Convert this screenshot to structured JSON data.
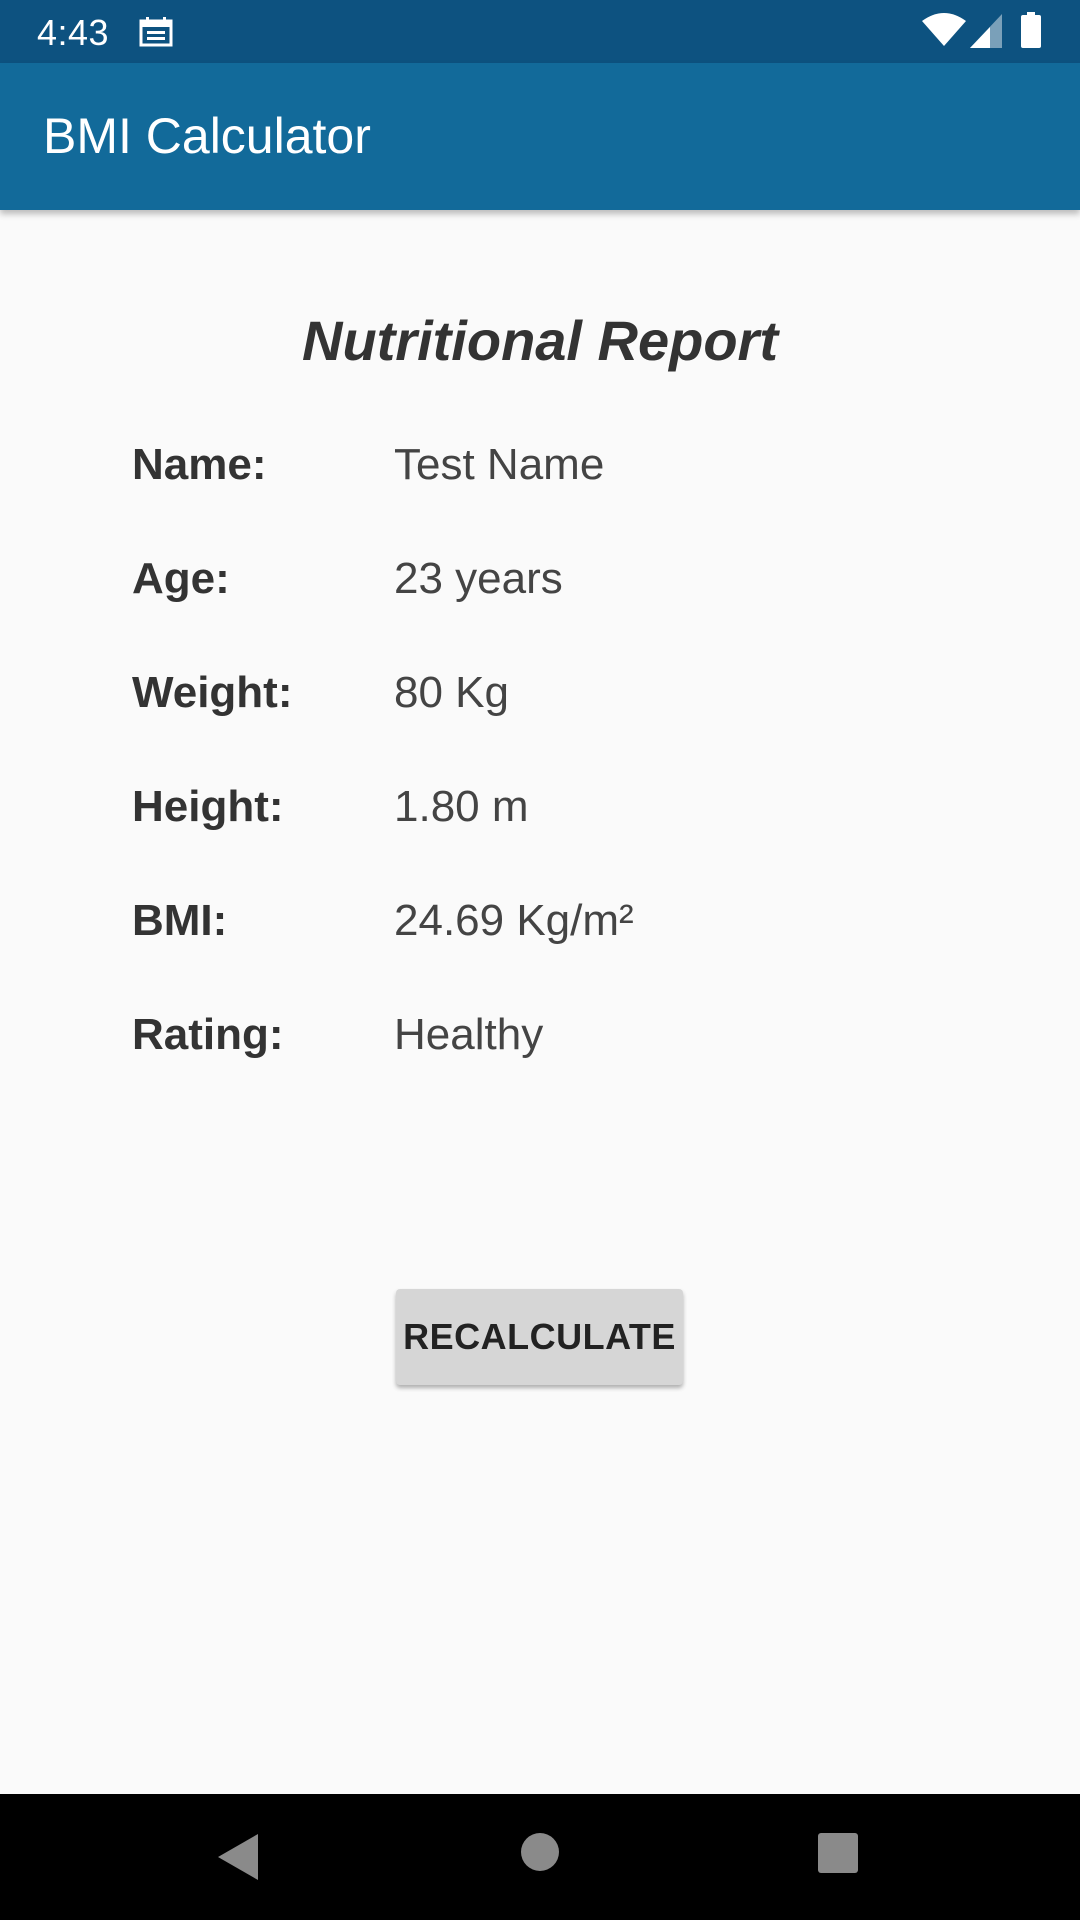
{
  "status_bar": {
    "time": "4:43",
    "icons": [
      "calendar-icon",
      "wifi-icon",
      "signal-icon",
      "battery-icon"
    ]
  },
  "app_bar": {
    "title": "BMI Calculator",
    "color": "#126a9a"
  },
  "report": {
    "title": "Nutritional Report",
    "rows": [
      {
        "label": "Name:",
        "value": "Test Name"
      },
      {
        "label": "Age:",
        "value": "23 years"
      },
      {
        "label": "Weight:",
        "value": "80 Kg"
      },
      {
        "label": "Height:",
        "value": "1.80 m"
      },
      {
        "label": "BMI:",
        "value": "24.69 Kg/m²"
      },
      {
        "label": "Rating:",
        "value": "Healthy"
      }
    ]
  },
  "actions": {
    "recalculate_label": "RECALCULATE"
  },
  "nav_bar": {
    "icons": [
      "back-icon",
      "home-icon",
      "recents-icon"
    ]
  },
  "colors": {
    "status_bar": "#0d5280",
    "app_bar": "#126a9a",
    "background": "#fafafa",
    "button": "#d6d6d6"
  }
}
